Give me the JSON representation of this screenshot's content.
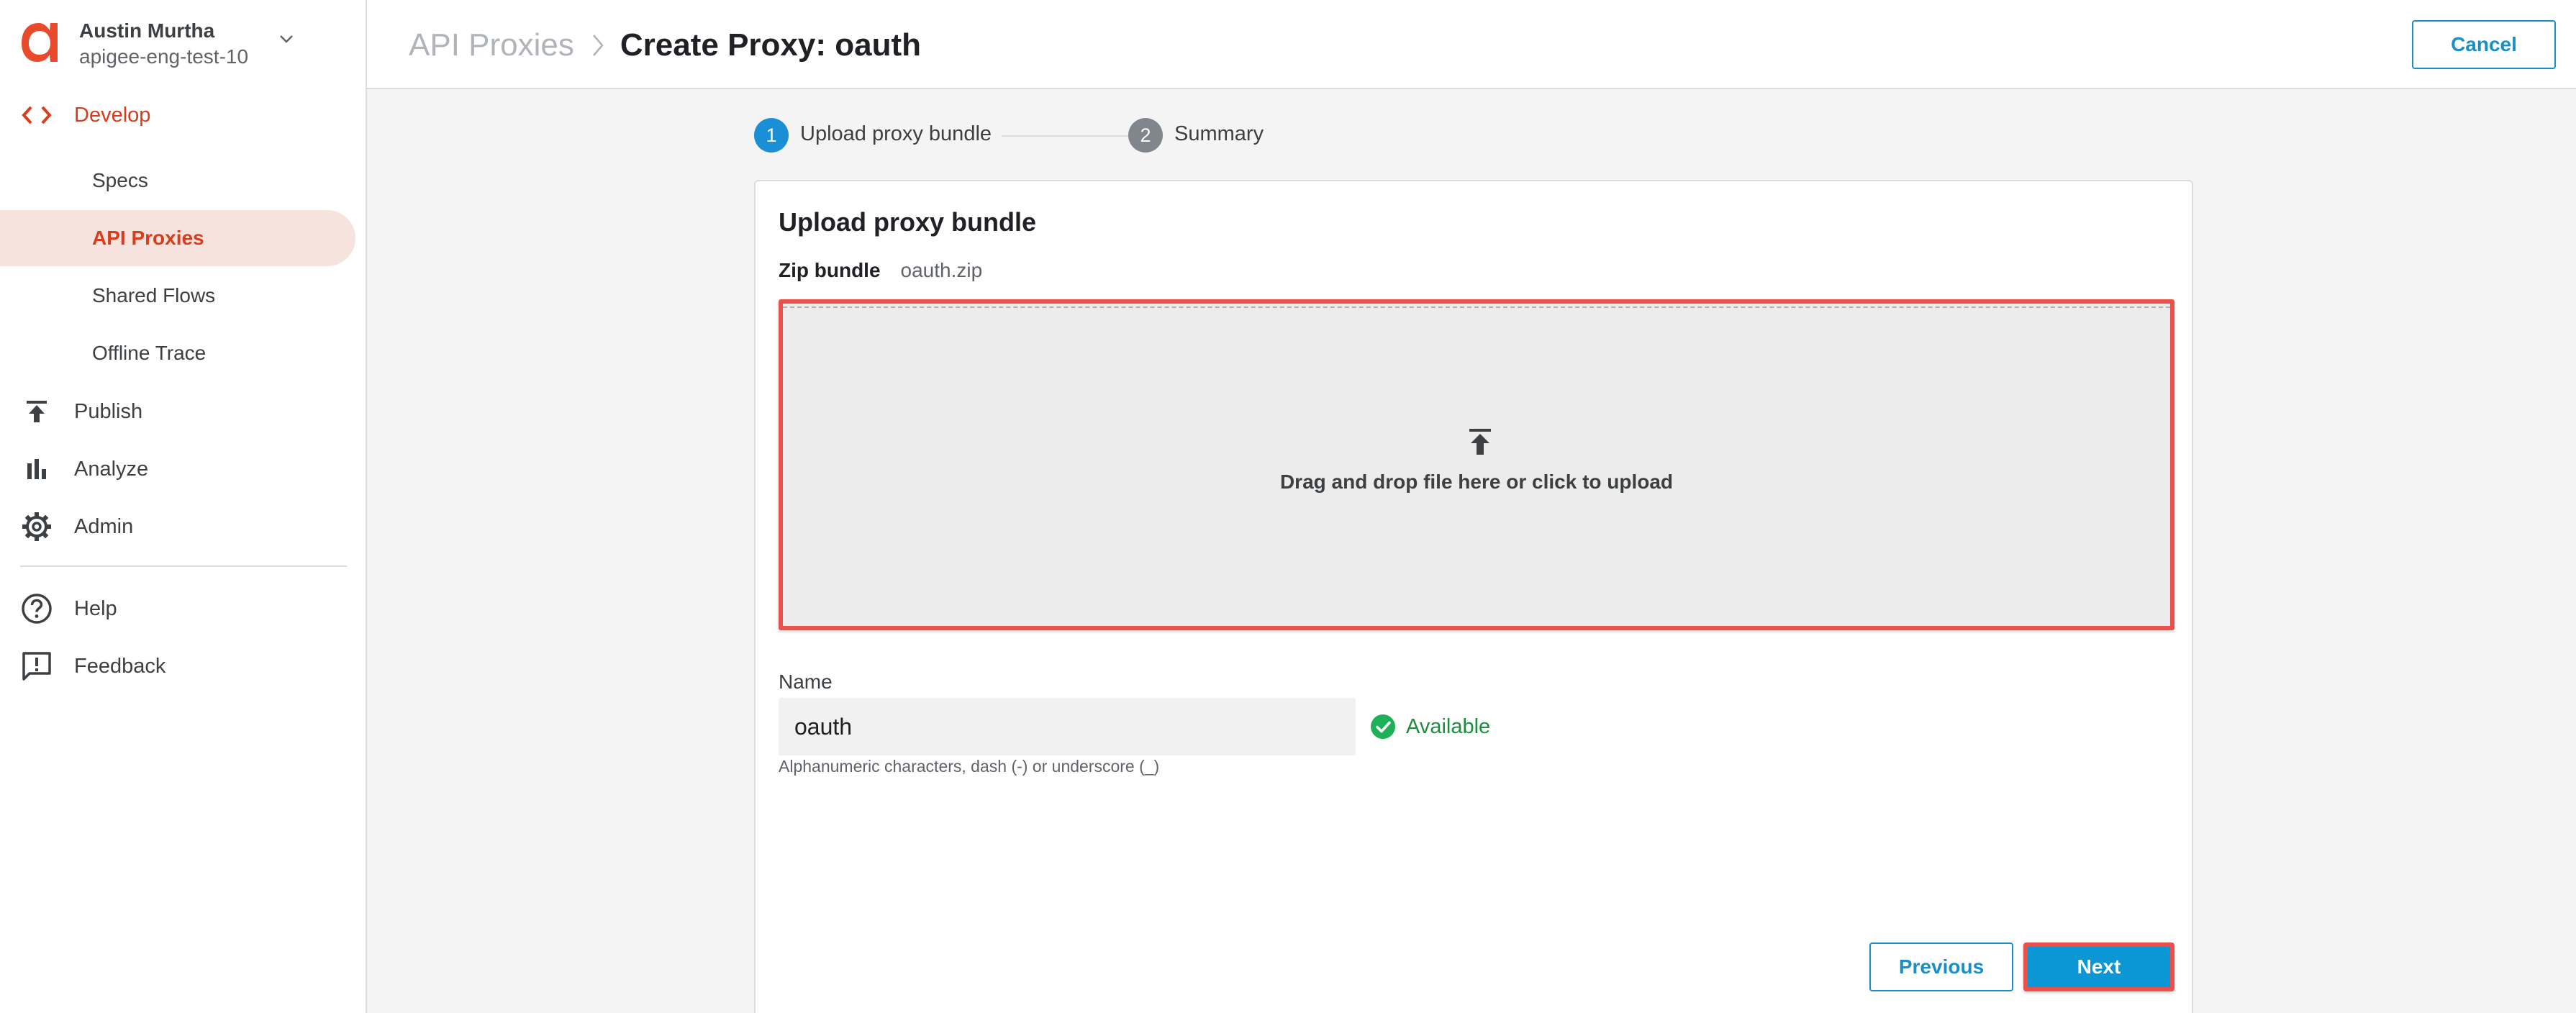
{
  "user": {
    "name": "Austin Murtha",
    "org": "apigee-eng-test-10"
  },
  "nav": {
    "develop": "Develop",
    "sub_items": [
      "Specs",
      "API Proxies",
      "Shared Flows",
      "Offline Trace"
    ],
    "publish": "Publish",
    "analyze": "Analyze",
    "admin": "Admin",
    "help": "Help",
    "feedback": "Feedback"
  },
  "header": {
    "breadcrumb_link": "API Proxies",
    "title": "Create Proxy: oauth",
    "cancel_label": "Cancel"
  },
  "stepper": {
    "steps": [
      {
        "number": "1",
        "label": "Upload proxy bundle"
      },
      {
        "number": "2",
        "label": "Summary"
      }
    ]
  },
  "card": {
    "title": "Upload proxy bundle",
    "zip_label": "Zip bundle",
    "zip_value": "oauth.zip",
    "dropzone_text": "Drag and drop file here or click to upload",
    "name_label": "Name",
    "name_value": "oauth",
    "availability": "Available",
    "name_hint": "Alphanumeric characters, dash (-) or underscore (_)",
    "previous_label": "Previous",
    "next_label": "Next"
  },
  "colors": {
    "accent": "#d93c1a",
    "primary": "#0b97d6",
    "success": "#1e8e3e",
    "highlight": "#e8524a"
  },
  "icons": {
    "logo": "apigee-logo",
    "develop": "code-brackets-icon",
    "publish": "publish-upload-icon",
    "analyze": "bar-chart-icon",
    "admin": "gear-icon",
    "help": "help-circle-icon",
    "feedback": "feedback-icon",
    "upload": "upload-icon",
    "available": "check-circle-icon"
  }
}
